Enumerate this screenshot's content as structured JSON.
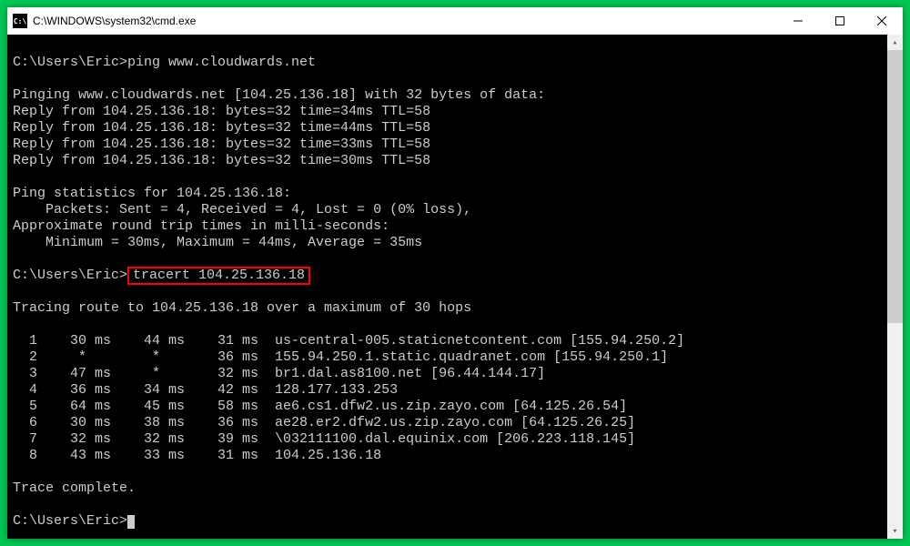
{
  "window": {
    "title": "C:\\WINDOWS\\system32\\cmd.exe",
    "icon_text": "C:\\"
  },
  "pingCmd": {
    "prompt": "C:\\Users\\Eric>",
    "command": "ping www.cloudwards.net"
  },
  "pingOutput": {
    "header": "Pinging www.cloudwards.net [104.25.136.18] with 32 bytes of data:",
    "replies": [
      "Reply from 104.25.136.18: bytes=32 time=34ms TTL=58",
      "Reply from 104.25.136.18: bytes=32 time=44ms TTL=58",
      "Reply from 104.25.136.18: bytes=32 time=33ms TTL=58",
      "Reply from 104.25.136.18: bytes=32 time=30ms TTL=58"
    ],
    "statsHeader": "Ping statistics for 104.25.136.18:",
    "packets": "    Packets: Sent = 4, Received = 4, Lost = 0 (0% loss),",
    "rttHeader": "Approximate round trip times in milli-seconds:",
    "rtt": "    Minimum = 30ms, Maximum = 44ms, Average = 35ms"
  },
  "tracertCmd": {
    "prompt": "C:\\Users\\Eric>",
    "command": "tracert 104.25.136.18"
  },
  "tracertOutput": {
    "header": "Tracing route to 104.25.136.18 over a maximum of 30 hops",
    "hops": [
      "  1    30 ms    44 ms    31 ms  us-central-005.staticnetcontent.com [155.94.250.2]",
      "  2     *        *       36 ms  155.94.250.1.static.quadranet.com [155.94.250.1]",
      "  3    47 ms     *       32 ms  br1.dal.as8100.net [96.44.144.17]",
      "  4    36 ms    34 ms    42 ms  128.177.133.253",
      "  5    64 ms    45 ms    58 ms  ae6.cs1.dfw2.us.zip.zayo.com [64.125.26.54]",
      "  6    30 ms    38 ms    36 ms  ae28.er2.dfw2.us.zip.zayo.com [64.125.26.25]",
      "  7    32 ms    32 ms    39 ms  \\032111100.dal.equinix.com [206.223.118.145]",
      "  8    43 ms    33 ms    31 ms  104.25.136.18"
    ],
    "complete": "Trace complete."
  },
  "finalPrompt": "C:\\Users\\Eric>"
}
